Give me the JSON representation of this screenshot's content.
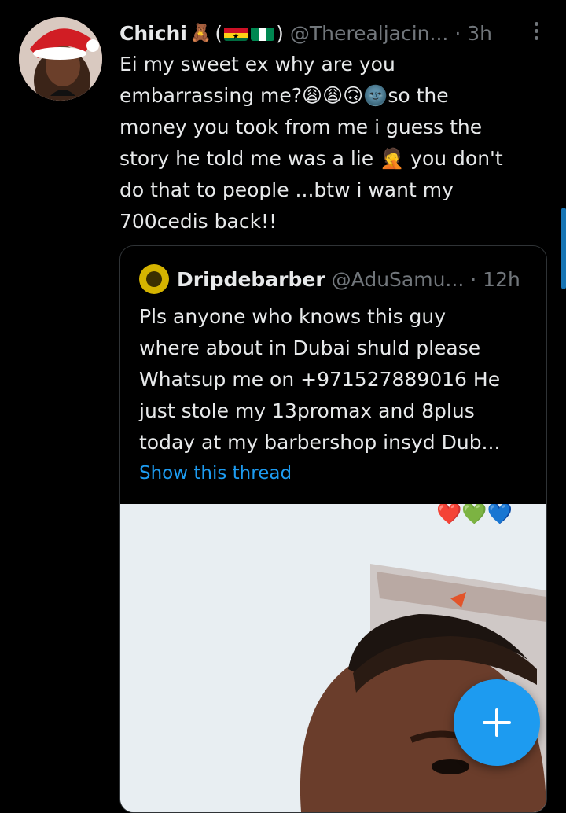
{
  "tweet": {
    "author_name": "Chichi",
    "author_emoji": "🧸",
    "flags_open": "(",
    "flags_close": ")",
    "handle": "@Therealjacin...",
    "time": "· 3h",
    "text": "Ei my sweet ex why are you\nembarrassing me?😩😩🙃🌚so the\nmoney you took from me i guess the\nstory he told me was a lie 🤦 you don't\ndo that to people ...btw i want my\n700cedis back!!"
  },
  "quote": {
    "author_name": "Dripdebarber",
    "handle": "@AduSamu...",
    "time": "· 12h",
    "text": "Pls anyone who knows this guy\nwhere about in Dubai shuld please\nWhatsup me on +971527889016 He\njust stole my 13promax and 8plus\ntoday at my barbershop insyd Dub...",
    "show_thread": "Show this thread",
    "photo_hearts": "❤️💚💙"
  },
  "icons": {
    "more": "more-vertical-icon",
    "compose": "plus-icon"
  },
  "colors": {
    "background": "#000000",
    "text": "#e7e9ea",
    "muted": "#71767b",
    "accent": "#1d9bf0"
  }
}
